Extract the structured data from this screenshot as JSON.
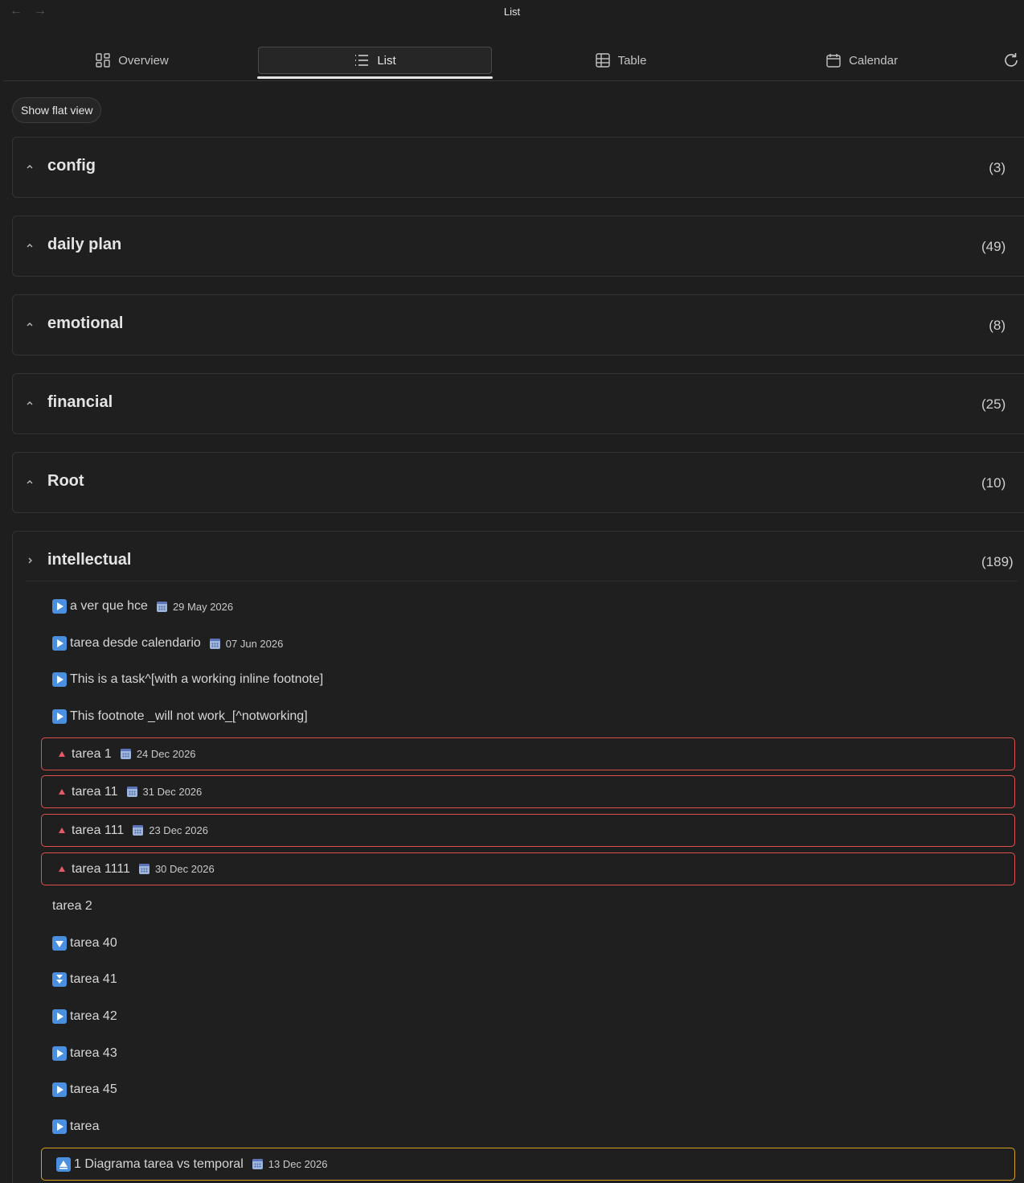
{
  "window": {
    "title": "List",
    "back_icon": "arrow-left-icon",
    "forward_icon": "arrow-right-icon"
  },
  "tabs": [
    {
      "label": "Overview",
      "icon": "grid-icon"
    },
    {
      "label": "List",
      "icon": "list-icon",
      "active": true
    },
    {
      "label": "Table",
      "icon": "table-icon"
    },
    {
      "label": "Calendar",
      "icon": "calendar-icon"
    }
  ],
  "refresh_icon": "refresh-icon",
  "flat_view_label": "Show flat view",
  "groups": [
    {
      "name": "config",
      "count": "(3)"
    },
    {
      "name": "daily plan",
      "count": "(49)"
    },
    {
      "name": "emotional",
      "count": "(8)"
    },
    {
      "name": "financial",
      "count": "(25)"
    },
    {
      "name": "Root",
      "count": "(10)"
    },
    {
      "name": "intellectual",
      "count": "(189)"
    }
  ],
  "tasks": [
    {
      "text": "a ver que hce",
      "priority_icon": "play-icon",
      "due": "29 May 2026"
    },
    {
      "text": "tarea desde calendario",
      "priority_icon": "play-icon",
      "due": "07 Jun 2026"
    },
    {
      "text": "This is a task^[with a working inline footnote]",
      "priority_icon": "play-icon"
    },
    {
      "text": "This footnote _will not work_[^notworking]",
      "priority_icon": "play-icon"
    },
    {
      "text": "tarea 1",
      "priority_icon": "high-priority-triangle-icon",
      "due": "24 Dec 2026"
    },
    {
      "text": "tarea 11",
      "priority_icon": "high-priority-triangle-icon",
      "due": "31 Dec 2026"
    },
    {
      "text": "tarea 111",
      "priority_icon": "high-priority-triangle-icon",
      "due": "23 Dec 2026"
    },
    {
      "text": "tarea 1111",
      "priority_icon": "high-priority-triangle-icon",
      "due": "30 Dec 2026"
    },
    {
      "text": "tarea 2"
    },
    {
      "text": "tarea 40",
      "priority_icon": "down-icon"
    },
    {
      "text": "tarea 41",
      "priority_icon": "double-down-icon"
    },
    {
      "text": "tarea 42",
      "priority_icon": "play-icon"
    },
    {
      "text": "tarea 43",
      "priority_icon": "play-icon"
    },
    {
      "text": "tarea 45",
      "priority_icon": "play-icon"
    },
    {
      "text": "tarea",
      "priority_icon": "play-icon"
    },
    {
      "text": "1 Diagrama tarea vs temporal",
      "priority_icon": "up-icon",
      "due": "13 Dec 2026"
    }
  ],
  "colors": {
    "background": "#1e1e1e",
    "high_priority_border": "#e0504f",
    "medium_priority_border": "#d6a020",
    "priority_icon_blue": "#4a8fe0"
  }
}
